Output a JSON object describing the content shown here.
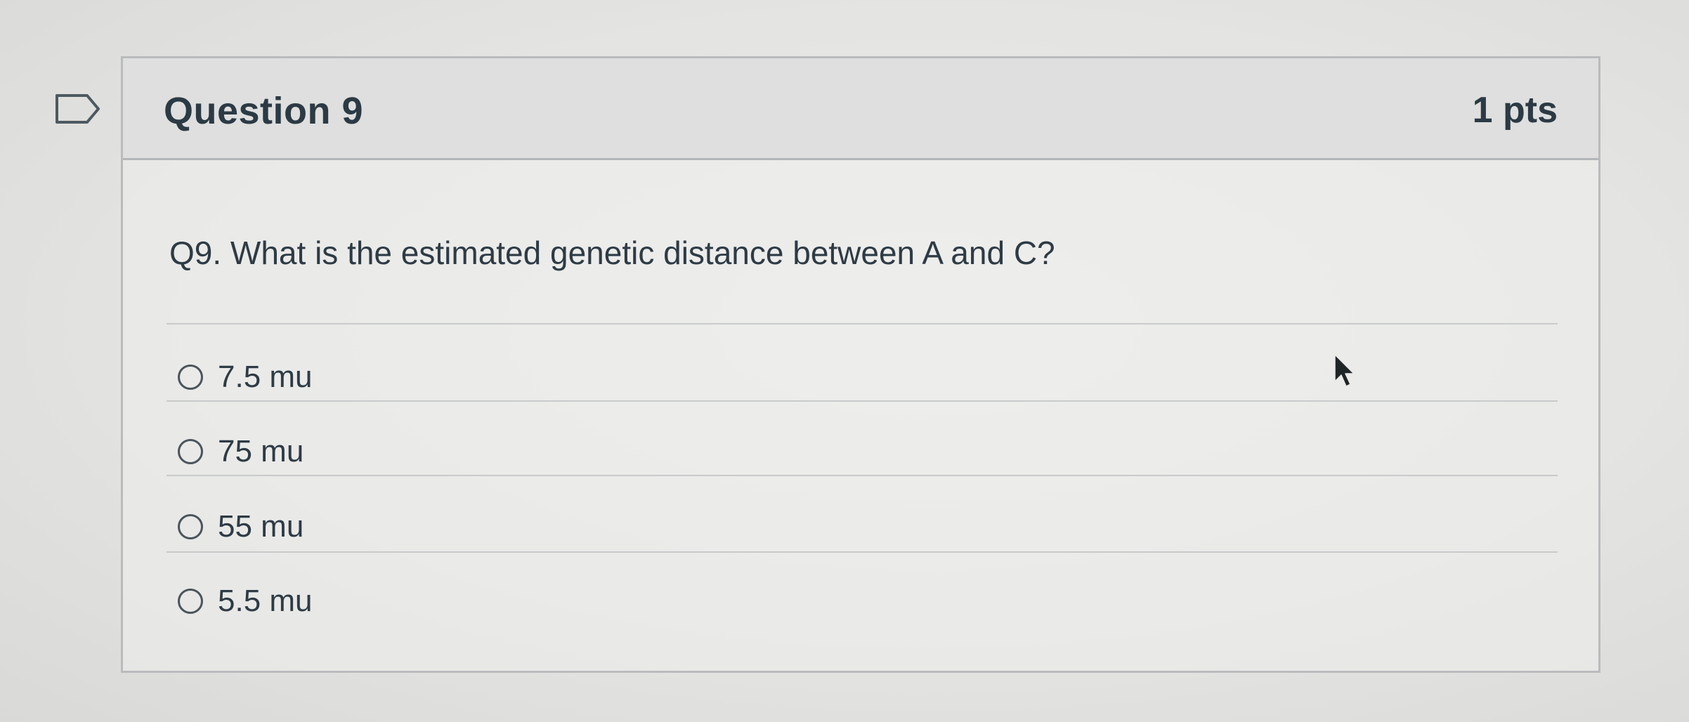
{
  "question": {
    "title": "Question 9",
    "points": "1 pts",
    "text": "Q9. What is the estimated genetic distance between A and C?",
    "flag_icon": "bookmark-flag-icon"
  },
  "answers": [
    {
      "label": "7.5 mu",
      "selected": false
    },
    {
      "label": "75 mu",
      "selected": false
    },
    {
      "label": "55 mu",
      "selected": false
    },
    {
      "label": "5.5 mu",
      "selected": false
    }
  ],
  "colors": {
    "text": "#2d3b45",
    "header_bg": "#dedfde",
    "border": "#b9bbbd"
  }
}
